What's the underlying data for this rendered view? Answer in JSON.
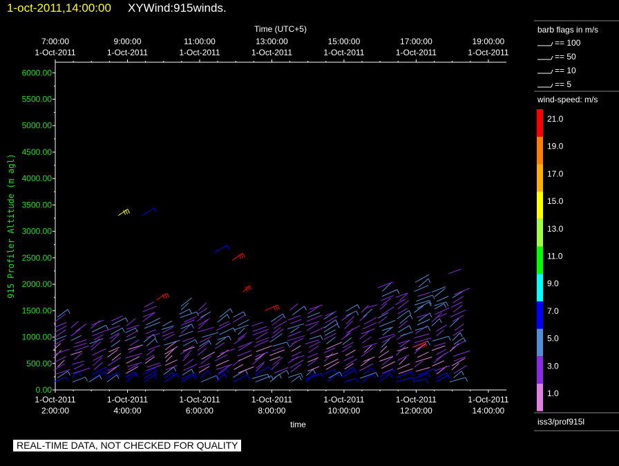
{
  "header": {
    "datetime": "1-oct-2011,14:00:00",
    "plot_name": "XYWind:915winds."
  },
  "legend": {
    "flags_title": "barb flags in m/s",
    "flags": [
      "== 100",
      "== 50",
      "== 10",
      "== 5"
    ],
    "speed_title": "wind-speed: m/s",
    "speed_levels": [
      21.0,
      19.0,
      17.0,
      15.0,
      13.0,
      11.0,
      9.0,
      7.0,
      5.0,
      3.0,
      1.0
    ],
    "speed_labels": [
      "21.0",
      "19.0",
      "17.0",
      "15.0",
      "13.0",
      "11.0",
      "9.0",
      "7.0",
      "5.0",
      "3.0",
      "1.0"
    ],
    "speed_colors": [
      "#ff0000",
      "#ff8000",
      "#ffb000",
      "#ffff00",
      "#a0ff40",
      "#00ff00",
      "#00ffff",
      "#0000ff",
      "#4f8fd8",
      "#8a2be2",
      "#e080e0"
    ],
    "source": "iss3/prof915l"
  },
  "quality_note": "REAL-TIME DATA, NOT CHECKED FOR QUALITY",
  "chart_data": {
    "type": "scatter",
    "subtype": "wind-barbs",
    "title": "",
    "xlabel": "time",
    "x2label": "Time (UTC+5)",
    "ylabel": "915 Profiler Altitude (m agl)",
    "ylim": [
      0,
      6200
    ],
    "yticks": [
      "0.00",
      "500.00",
      "1000.00",
      "1500.00",
      "2000.00",
      "2500.00",
      "3000.00",
      "3500.00",
      "4000.00",
      "4500.00",
      "5000.00",
      "5500.00",
      "6000.00"
    ],
    "xticks_bottom": [
      {
        "time": "2:00:00",
        "date": "1-Oct-2011"
      },
      {
        "time": "4:00:00",
        "date": "1-Oct-2011"
      },
      {
        "time": "6:00:00",
        "date": "1-Oct-2011"
      },
      {
        "time": "8:00:00",
        "date": "1-Oct-2011"
      },
      {
        "time": "10:00:00",
        "date": "1-Oct-2011"
      },
      {
        "time": "12:00:00",
        "date": "1-Oct-2011"
      },
      {
        "time": "14:00:00",
        "date": "1-Oct-2011"
      }
    ],
    "xticks_top": [
      {
        "time": "7:00:00",
        "date": "1-Oct-2011"
      },
      {
        "time": "9:00:00",
        "date": "1-Oct-2011"
      },
      {
        "time": "11:00:00",
        "date": "1-Oct-2011"
      },
      {
        "time": "13:00:00",
        "date": "1-Oct-2011"
      },
      {
        "time": "15:00:00",
        "date": "1-Oct-2011"
      },
      {
        "time": "17:00:00",
        "date": "1-Oct-2011"
      },
      {
        "time": "19:00:00",
        "date": "1-Oct-2011"
      }
    ],
    "xlim_hours_utc": [
      2,
      14.5
    ],
    "profile_times_utc_hours": [
      2.0,
      2.5,
      3.0,
      3.5,
      4.0,
      4.5,
      5.0,
      5.5,
      6.0,
      6.5,
      7.0,
      7.5,
      8.0,
      8.5,
      9.0,
      9.5,
      10.0,
      10.5,
      11.0,
      11.5,
      12.0,
      12.5,
      13.0
    ],
    "surface_layer": {
      "max_alt_m": 800,
      "typical_speed_mps": 3
    },
    "near_ground_layer": {
      "max_alt_m": 300,
      "typical_speed_mps": 6
    },
    "notable_barbs": [
      {
        "time_utc_h": 3.75,
        "alt_m": 3300,
        "speed_mps": 15
      },
      {
        "time_utc_h": 4.4,
        "alt_m": 3300,
        "speed_mps": 7
      },
      {
        "time_utc_h": 4.8,
        "alt_m": 1700,
        "speed_mps": 21
      },
      {
        "time_utc_h": 6.9,
        "alt_m": 2450,
        "speed_mps": 21
      },
      {
        "time_utc_h": 7.2,
        "alt_m": 1850,
        "speed_mps": 21
      },
      {
        "time_utc_h": 7.8,
        "alt_m": 1500,
        "speed_mps": 21
      },
      {
        "time_utc_h": 11.9,
        "alt_m": 800,
        "speed_mps": 21
      },
      {
        "time_utc_h": 6.4,
        "alt_m": 2600,
        "speed_mps": 7
      },
      {
        "time_utc_h": 12.9,
        "alt_m": 2200,
        "speed_mps": 3
      }
    ]
  }
}
